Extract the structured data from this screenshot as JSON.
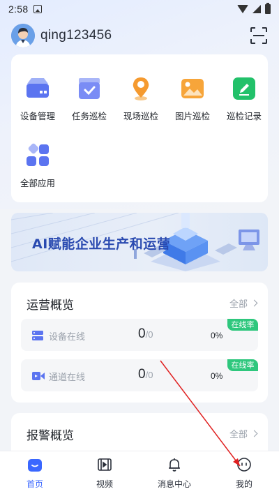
{
  "statusbar": {
    "time": "2:58"
  },
  "user": {
    "name": "qing123456"
  },
  "apps": [
    {
      "label": "设备管理",
      "icon": "device-management-icon",
      "color": "#5b74f0"
    },
    {
      "label": "任务巡检",
      "icon": "task-inspection-icon",
      "color": "#7a8cf5"
    },
    {
      "label": "现场巡检",
      "icon": "site-inspection-icon",
      "color": "#f59a2f"
    },
    {
      "label": "图片巡检",
      "icon": "image-inspection-icon",
      "color": "#f7a53a"
    },
    {
      "label": "巡检记录",
      "icon": "inspection-record-icon",
      "color": "#22c16a"
    },
    {
      "label": "全部应用",
      "icon": "all-apps-icon",
      "color": "#5b74f0"
    }
  ],
  "banner": {
    "text": "AI赋能企业生产和运营"
  },
  "operations": {
    "title": "运营概览",
    "more": "全部",
    "rows": [
      {
        "label": "设备在线",
        "value": "0",
        "total": "/0",
        "percent": "0%",
        "badge": "在线率",
        "icon": "server-icon"
      },
      {
        "label": "通道在线",
        "value": "0",
        "total": "/0",
        "percent": "0%",
        "badge": "在线率",
        "icon": "video-camera-icon"
      }
    ]
  },
  "alarms": {
    "title": "报警概览",
    "more": "全部"
  },
  "tabs": [
    {
      "label": "首页",
      "icon": "home-icon",
      "active": true
    },
    {
      "label": "视频",
      "icon": "video-icon",
      "active": false
    },
    {
      "label": "消息中心",
      "icon": "bell-icon",
      "active": false
    },
    {
      "label": "我的",
      "icon": "profile-icon",
      "active": false
    }
  ],
  "colors": {
    "accent": "#3a67ff",
    "online": "#2ec77d",
    "annotation_arrow": "#e02020"
  }
}
